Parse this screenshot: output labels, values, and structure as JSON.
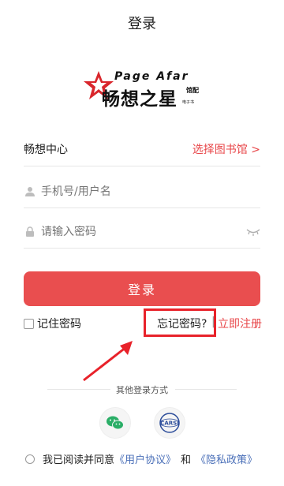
{
  "header": {
    "title": "登录"
  },
  "logo": {
    "english": "Page Afar",
    "chinese": "畅想之星",
    "sub_top": "馆配",
    "sub_bottom": "电子书"
  },
  "library": {
    "name": "畅想中心",
    "select_label": "选择图书馆 >"
  },
  "form": {
    "username_placeholder": "手机号/用户名",
    "password_placeholder": "请输入密码",
    "login_label": "登录"
  },
  "options": {
    "remember_label": "记住密码",
    "forgot_label": "忘记密码?",
    "separator": "|",
    "register_label": "立即注册"
  },
  "other_login": {
    "title": "其他登录方式",
    "providers": [
      {
        "name": "wechat-icon"
      },
      {
        "name": "carsi-icon",
        "text": "CARSI"
      }
    ]
  },
  "agreement": {
    "prefix": "我已阅读并同意",
    "user_agreement": "《用户协议》",
    "and": "和",
    "privacy_policy": "《隐私政策》"
  },
  "colors": {
    "accent": "#e94e4f",
    "link": "#4a6fb8",
    "highlight_box": "#e8222a"
  }
}
